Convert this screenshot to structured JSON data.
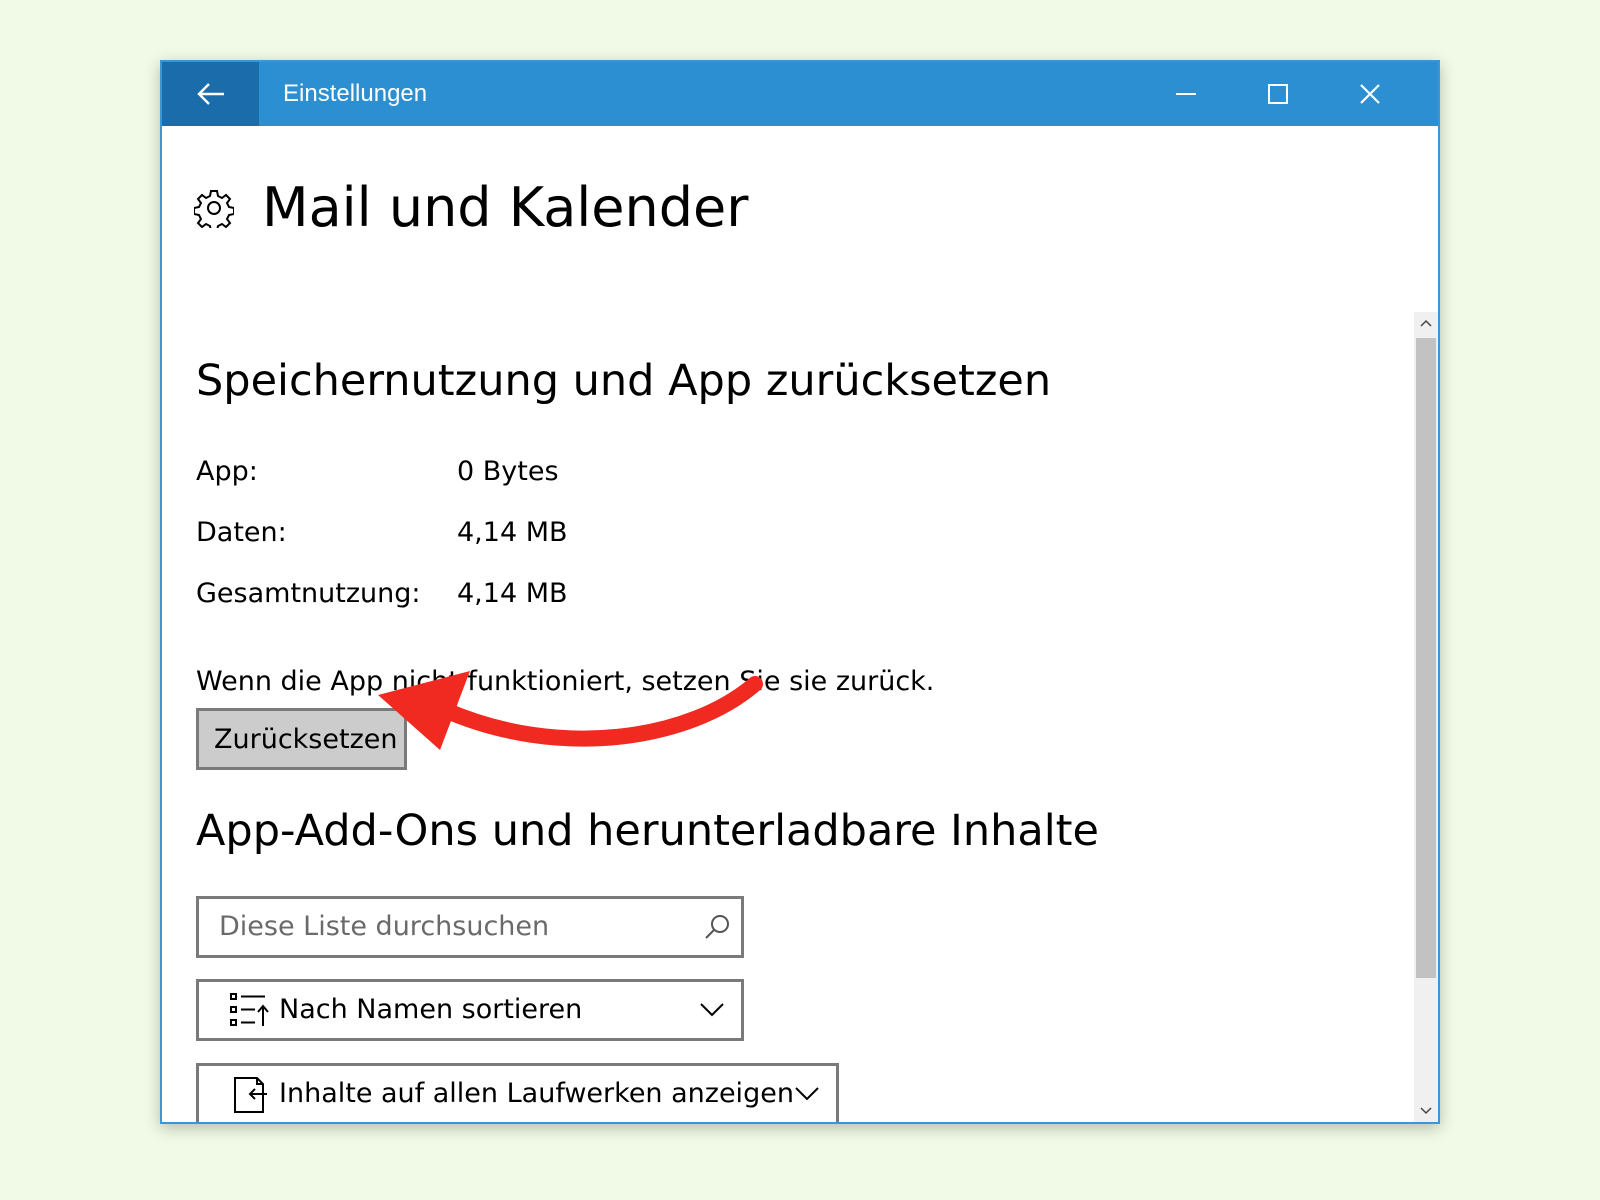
{
  "window": {
    "title": "Einstellungen",
    "controls": {
      "back": "arrow-left-icon",
      "minimize": "minimize-icon",
      "maximize": "maximize-icon",
      "close": "close-icon"
    },
    "accent_color": "#2b8fd1",
    "back_button_color": "#1a6cab"
  },
  "page": {
    "icon": "gear-icon",
    "title": "Mail und Kalender"
  },
  "storage": {
    "heading": "Speichernutzung und App zurücksetzen",
    "rows": [
      {
        "label": "App:",
        "value": "0 Bytes"
      },
      {
        "label": "Daten:",
        "value": "4,14 MB"
      },
      {
        "label": "Gesamtnutzung:",
        "value": "4,14 MB"
      }
    ],
    "description": "Wenn die App nicht funktioniert, setzen Sie sie zurück.",
    "reset_button": "Zurücksetzen"
  },
  "addons": {
    "heading": "App-Add-Ons und herunterladbare Inhalte",
    "search_placeholder": "Diese Liste durchsuchen",
    "sort_selected": "Nach Namen sortieren",
    "drive_filter_selected": "Inhalte auf allen Laufwerken anzeigen"
  },
  "annotation": {
    "color": "#f02a20",
    "points_to": "reset-button"
  }
}
